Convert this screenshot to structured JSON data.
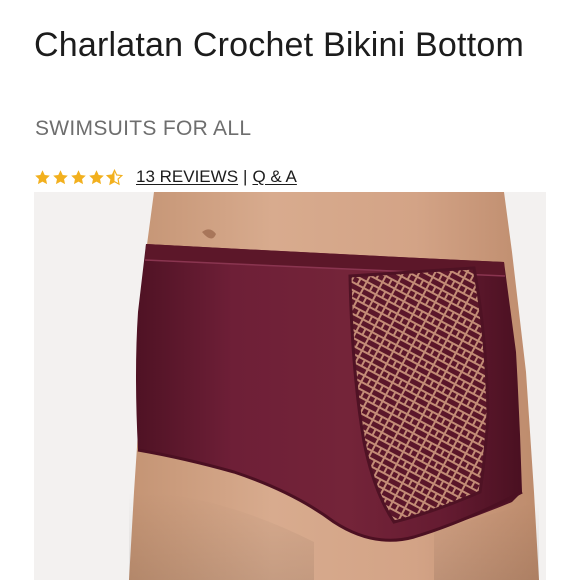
{
  "product": {
    "title": "Charlatan Crochet Bikini Bottom",
    "brand": "SWIMSUITS FOR ALL",
    "rating": 4.5,
    "reviews_label": "13 REVIEWS",
    "separator": "|",
    "qa_label": "Q & A",
    "image_icon": "product-photo"
  },
  "colors": {
    "star": "#f2b01e",
    "garment": "#6a1c33",
    "skin": "#d2a487",
    "background": "#f3f1f0"
  }
}
